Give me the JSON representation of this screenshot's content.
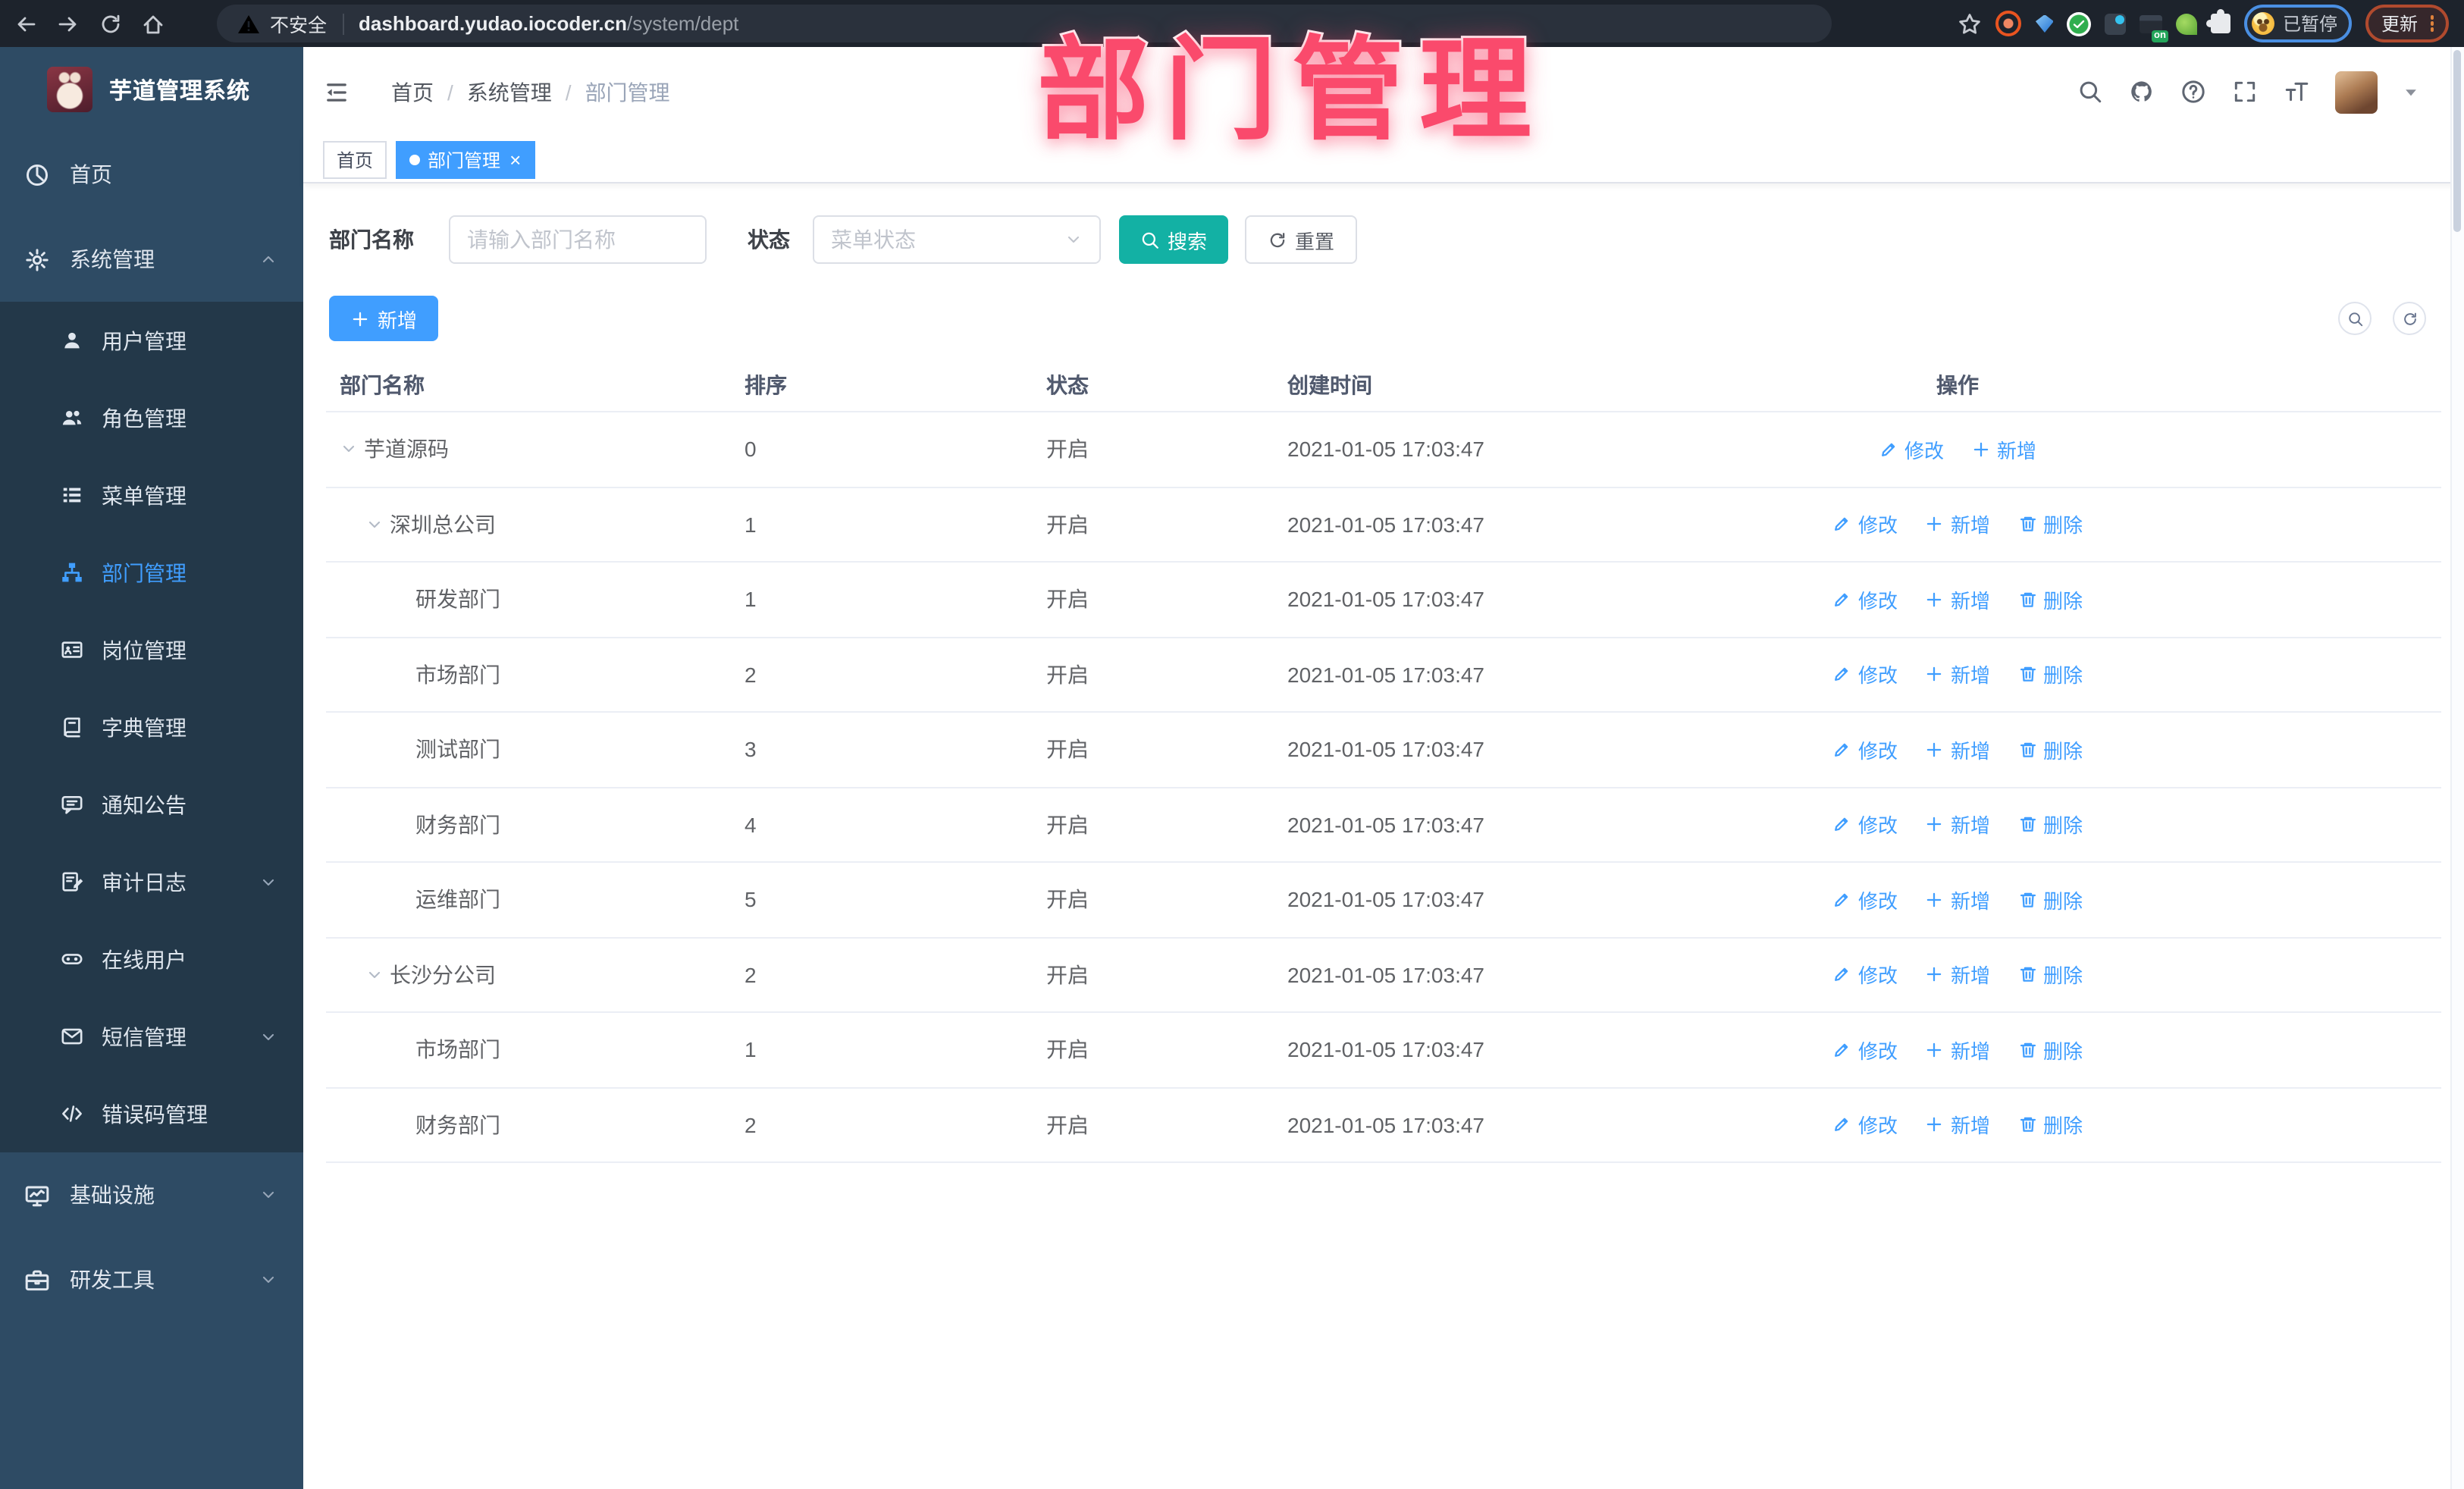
{
  "colors": {
    "primary": "#409eff",
    "search_button_teal": "#13b1a4",
    "overlay_pink": "#fa4a6c",
    "sidebar_bg": "#2e4b64",
    "sidebar_submenu_bg": "#233849",
    "chrome_bg": "#1d232c"
  },
  "overlay": {
    "title": "部门管理"
  },
  "browser": {
    "security_label": "不安全",
    "url_host": "dashboard.yudao.iocoder.cn",
    "url_path": "/system/dept",
    "extension_badge": "on",
    "paused_label": "已暂停",
    "update_label": "更新"
  },
  "sidebar": {
    "app_title": "芋道管理系统",
    "items": [
      {
        "key": "home",
        "label": "首页",
        "icon": "dashboard-icon",
        "level": 0
      },
      {
        "key": "system-management",
        "label": "系统管理",
        "icon": "gear-icon",
        "level": 0,
        "arrow": "up"
      },
      {
        "key": "user-management",
        "label": "用户管理",
        "icon": "user-icon",
        "level": 1
      },
      {
        "key": "role-management",
        "label": "角色管理",
        "icon": "users-icon",
        "level": 1
      },
      {
        "key": "menu-management",
        "label": "菜单管理",
        "icon": "menu-list-icon",
        "level": 1
      },
      {
        "key": "dept-management",
        "label": "部门管理",
        "icon": "org-tree-icon",
        "level": 1,
        "active": true
      },
      {
        "key": "post-management",
        "label": "岗位管理",
        "icon": "id-card-icon",
        "level": 1
      },
      {
        "key": "dict-management",
        "label": "字典管理",
        "icon": "dictionary-icon",
        "level": 1
      },
      {
        "key": "notice-announcement",
        "label": "通知公告",
        "icon": "announcement-icon",
        "level": 1
      },
      {
        "key": "audit-log",
        "label": "审计日志",
        "icon": "audit-log-icon",
        "level": 1,
        "arrow": "down"
      },
      {
        "key": "online-users",
        "label": "在线用户",
        "icon": "online-users-icon",
        "level": 1
      },
      {
        "key": "sms-management",
        "label": "短信管理",
        "icon": "sms-icon",
        "level": 1,
        "arrow": "down"
      },
      {
        "key": "error-code-management",
        "label": "错误码管理",
        "icon": "error-code-icon",
        "level": 1
      },
      {
        "key": "infrastructure",
        "label": "基础设施",
        "icon": "infrastructure-icon",
        "level": 0,
        "arrow": "down"
      },
      {
        "key": "dev-tools",
        "label": "研发工具",
        "icon": "dev-tools-icon",
        "level": 0,
        "arrow": "down"
      }
    ]
  },
  "header": {
    "breadcrumb": [
      "首页",
      "系统管理",
      "部门管理"
    ]
  },
  "tabs": [
    {
      "key": "home",
      "label": "首页",
      "active": false,
      "closable": false
    },
    {
      "key": "dept-management",
      "label": "部门管理",
      "active": true,
      "closable": true
    }
  ],
  "filters": {
    "dept_name_label": "部门名称",
    "dept_name_placeholder": "请输入部门名称",
    "dept_name_value": "",
    "status_label": "状态",
    "status_placeholder": "菜单状态",
    "search_label": "搜索",
    "reset_label": "重置"
  },
  "toolbar": {
    "add_label": "新增"
  },
  "table": {
    "columns": [
      {
        "key": "name",
        "label": "部门名称"
      },
      {
        "key": "sort",
        "label": "排序"
      },
      {
        "key": "status",
        "label": "状态"
      },
      {
        "key": "created",
        "label": "创建时间"
      },
      {
        "key": "actions",
        "label": "操作"
      }
    ],
    "rows": [
      {
        "name": "芋道源码",
        "level": 0,
        "expanded": true,
        "sort": "0",
        "status": "开启",
        "created": "2021-01-05 17:03:47",
        "actions": [
          {
            "key": "edit",
            "label": "修改",
            "icon": "edit-icon"
          },
          {
            "key": "add",
            "label": "新增",
            "icon": "plus-icon"
          }
        ]
      },
      {
        "name": "深圳总公司",
        "level": 1,
        "expanded": true,
        "sort": "1",
        "status": "开启",
        "created": "2021-01-05 17:03:47",
        "actions": [
          {
            "key": "edit",
            "label": "修改",
            "icon": "edit-icon"
          },
          {
            "key": "add",
            "label": "新增",
            "icon": "plus-icon"
          },
          {
            "key": "delete",
            "label": "删除",
            "icon": "trash-icon"
          }
        ]
      },
      {
        "name": "研发部门",
        "level": 2,
        "expanded": false,
        "sort": "1",
        "status": "开启",
        "created": "2021-01-05 17:03:47",
        "actions": [
          {
            "key": "edit",
            "label": "修改",
            "icon": "edit-icon"
          },
          {
            "key": "add",
            "label": "新增",
            "icon": "plus-icon"
          },
          {
            "key": "delete",
            "label": "删除",
            "icon": "trash-icon"
          }
        ]
      },
      {
        "name": "市场部门",
        "level": 2,
        "expanded": false,
        "sort": "2",
        "status": "开启",
        "created": "2021-01-05 17:03:47",
        "actions": [
          {
            "key": "edit",
            "label": "修改",
            "icon": "edit-icon"
          },
          {
            "key": "add",
            "label": "新增",
            "icon": "plus-icon"
          },
          {
            "key": "delete",
            "label": "删除",
            "icon": "trash-icon"
          }
        ]
      },
      {
        "name": "测试部门",
        "level": 2,
        "expanded": false,
        "sort": "3",
        "status": "开启",
        "created": "2021-01-05 17:03:47",
        "actions": [
          {
            "key": "edit",
            "label": "修改",
            "icon": "edit-icon"
          },
          {
            "key": "add",
            "label": "新增",
            "icon": "plus-icon"
          },
          {
            "key": "delete",
            "label": "删除",
            "icon": "trash-icon"
          }
        ]
      },
      {
        "name": "财务部门",
        "level": 2,
        "expanded": false,
        "sort": "4",
        "status": "开启",
        "created": "2021-01-05 17:03:47",
        "actions": [
          {
            "key": "edit",
            "label": "修改",
            "icon": "edit-icon"
          },
          {
            "key": "add",
            "label": "新增",
            "icon": "plus-icon"
          },
          {
            "key": "delete",
            "label": "删除",
            "icon": "trash-icon"
          }
        ]
      },
      {
        "name": "运维部门",
        "level": 2,
        "expanded": false,
        "sort": "5",
        "status": "开启",
        "created": "2021-01-05 17:03:47",
        "actions": [
          {
            "key": "edit",
            "label": "修改",
            "icon": "edit-icon"
          },
          {
            "key": "add",
            "label": "新增",
            "icon": "plus-icon"
          },
          {
            "key": "delete",
            "label": "删除",
            "icon": "trash-icon"
          }
        ]
      },
      {
        "name": "长沙分公司",
        "level": 1,
        "expanded": true,
        "sort": "2",
        "status": "开启",
        "created": "2021-01-05 17:03:47",
        "actions": [
          {
            "key": "edit",
            "label": "修改",
            "icon": "edit-icon"
          },
          {
            "key": "add",
            "label": "新增",
            "icon": "plus-icon"
          },
          {
            "key": "delete",
            "label": "删除",
            "icon": "trash-icon"
          }
        ]
      },
      {
        "name": "市场部门",
        "level": 2,
        "expanded": false,
        "sort": "1",
        "status": "开启",
        "created": "2021-01-05 17:03:47",
        "actions": [
          {
            "key": "edit",
            "label": "修改",
            "icon": "edit-icon"
          },
          {
            "key": "add",
            "label": "新增",
            "icon": "plus-icon"
          },
          {
            "key": "delete",
            "label": "删除",
            "icon": "trash-icon"
          }
        ]
      },
      {
        "name": "财务部门",
        "level": 2,
        "expanded": false,
        "sort": "2",
        "status": "开启",
        "created": "2021-01-05 17:03:47",
        "actions": [
          {
            "key": "edit",
            "label": "修改",
            "icon": "edit-icon"
          },
          {
            "key": "add",
            "label": "新增",
            "icon": "plus-icon"
          },
          {
            "key": "delete",
            "label": "删除",
            "icon": "trash-icon"
          }
        ]
      }
    ]
  }
}
